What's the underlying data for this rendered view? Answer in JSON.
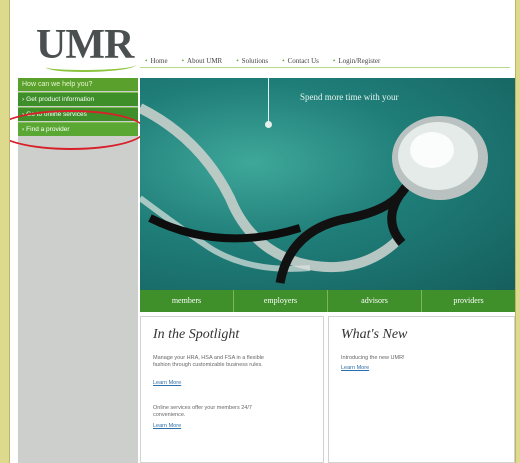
{
  "header": {
    "logo": "UMR"
  },
  "topnav": [
    "Home",
    "About UMR",
    "Solutions",
    "Contact Us",
    "Login/Register"
  ],
  "sidebar": {
    "heading": "How can we help you?",
    "items": [
      "Get product information",
      "Go to online services",
      "Find a provider"
    ]
  },
  "hero": {
    "tagline": "Spend more time with your"
  },
  "tabs": [
    "members",
    "employers",
    "advisors",
    "providers"
  ],
  "spotlight": {
    "title": "In the Spotlight",
    "text1": "Manage your HRA, HSA and FSA in a flexible fashion through customizable business rules.",
    "link1": "Learn More",
    "text2": "Online services offer your members 24/7 convenience.",
    "link2": "Learn More"
  },
  "news": {
    "title": "What's New",
    "text1": "Introducing the new UMR!",
    "link1": "Learn More"
  },
  "colors": {
    "brand_green": "#3e8f2a",
    "highlight": "#d9202a",
    "hero_teal": "#1f7d78"
  }
}
